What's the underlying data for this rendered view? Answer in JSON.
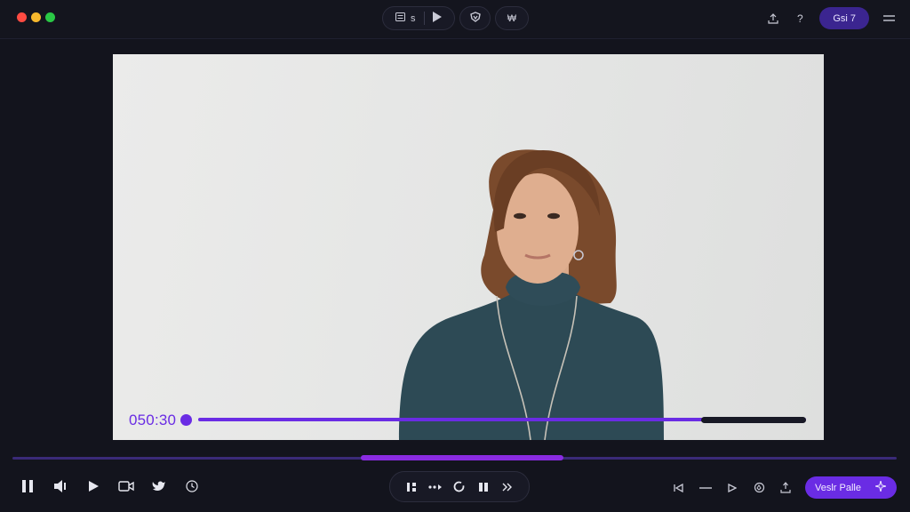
{
  "window": {
    "controls": [
      "close",
      "minimize",
      "maximize"
    ]
  },
  "toolbar": {
    "group1": {
      "icon": "list-icon",
      "label": "s",
      "play_icon": "play-icon"
    },
    "group2": {
      "icon": "sparkle-shield-icon"
    },
    "group3": {
      "label": "₩"
    },
    "right": {
      "share_icon": "share-icon",
      "help": "?",
      "account_label": "Gsi 7",
      "menu_icon": "menu-icon"
    }
  },
  "player": {
    "timecode": "050:30",
    "progress_fraction": 0.74
  },
  "timeline": {
    "selection_start_fraction": 0.393,
    "selection_end_fraction": 0.623
  },
  "controls_left": [
    "pause-icon",
    "volume-icon",
    "play-icon",
    "camera-icon",
    "twitter-icon",
    "clock-icon"
  ],
  "transport": [
    "split-icon",
    "dots-icon",
    "loop-icon",
    "pause-icon",
    "forward-icon"
  ],
  "controls_right": [
    "back-icon",
    "minus-icon",
    "play-icon",
    "effects-icon",
    "export-icon"
  ],
  "share": {
    "label": "Veslr Palle",
    "icon": "sparkle-icon"
  },
  "colors": {
    "accent": "#6a2ce4",
    "accent_dark": "#3b2590",
    "background": "#13141d"
  }
}
